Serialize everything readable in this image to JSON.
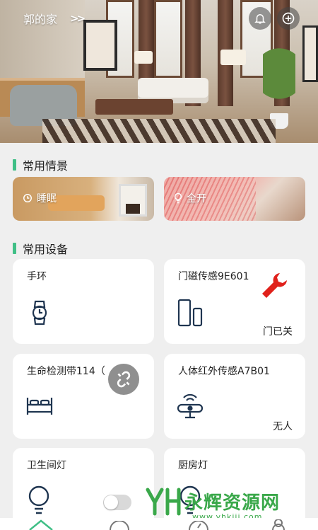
{
  "header": {
    "home_name": "郭的家",
    "expand_icon": "double-chevron-right-icon"
  },
  "top_actions": {
    "bell_icon": "bell-icon",
    "add_icon": "plus-circle-icon"
  },
  "scenes_section": {
    "title": "常用情景",
    "items": [
      {
        "label": "睡眠",
        "icon": "moon-clock-icon"
      },
      {
        "label": "全开",
        "icon": "light-bulb-icon"
      }
    ]
  },
  "devices_section": {
    "title": "常用设备",
    "devices": [
      {
        "name": "手环",
        "icon": "watch-icon",
        "status": ""
      },
      {
        "name": "门磁传感9E601",
        "icon": "door-sensor-icon",
        "status": "门已关",
        "badge": "wrench-icon"
      },
      {
        "name": "生命检测带114（",
        "icon": "bed-icon",
        "status": "",
        "badge": "unlink-icon"
      },
      {
        "name": "人体红外传感A7B01",
        "icon": "infrared-sensor-icon",
        "status": "无人"
      },
      {
        "name": "卫生间灯",
        "icon": "bulb-icon",
        "status": "",
        "toggle": "off"
      },
      {
        "name": "厨房灯",
        "icon": "bulb-icon",
        "status": ""
      }
    ]
  },
  "watermark": {
    "text": "永辉资源网",
    "url": "www.yhkjjj.com"
  },
  "colors": {
    "accent": "#3fbf86",
    "card": "#ffffff",
    "background": "#efefef",
    "alert": "#e0211b"
  }
}
